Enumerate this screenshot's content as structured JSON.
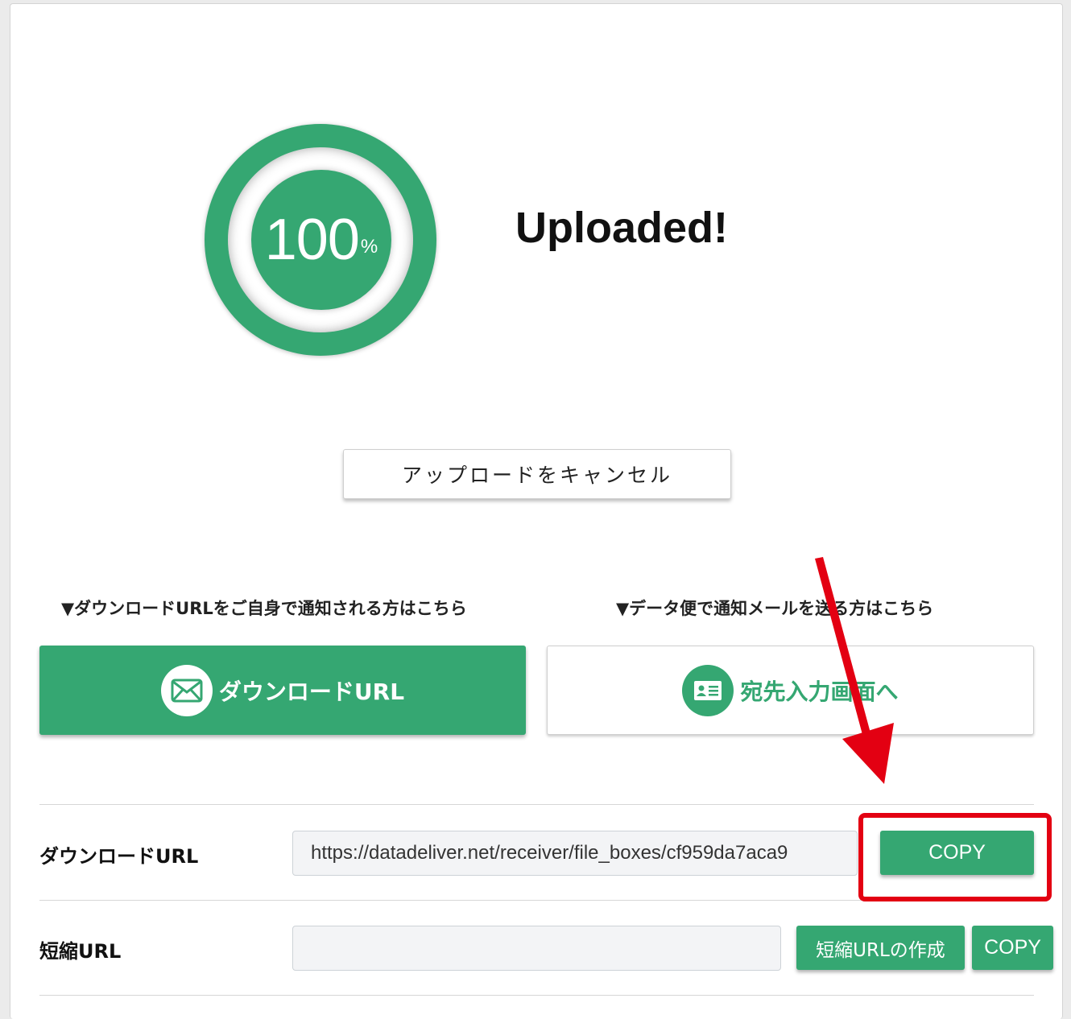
{
  "progress": {
    "percent": "100",
    "percent_sign": "%",
    "status": "Uploaded!"
  },
  "cancel_button": "アップロードをキャンセル",
  "captions": {
    "self_notify": "▼ダウンロードURLをご自身で通知される方はこちら",
    "mail_notify": "▼データ便で通知メールを送る方はこちら"
  },
  "buttons": {
    "download_url": "ダウンロードURL",
    "recipient_screen": "宛先入力画面へ"
  },
  "rows": {
    "download_url": {
      "label": "ダウンロードURL",
      "value": "https://datadeliver.net/receiver/file_boxes/cf959da7aca9",
      "copy": "COPY"
    },
    "short_url": {
      "label": "短縮URL",
      "value": "",
      "create": "短縮URLの作成",
      "copy": "COPY"
    }
  },
  "colors": {
    "accent": "#35a772",
    "annotation": "#e30012"
  },
  "icons": [
    "envelope-icon",
    "id-card-icon"
  ]
}
